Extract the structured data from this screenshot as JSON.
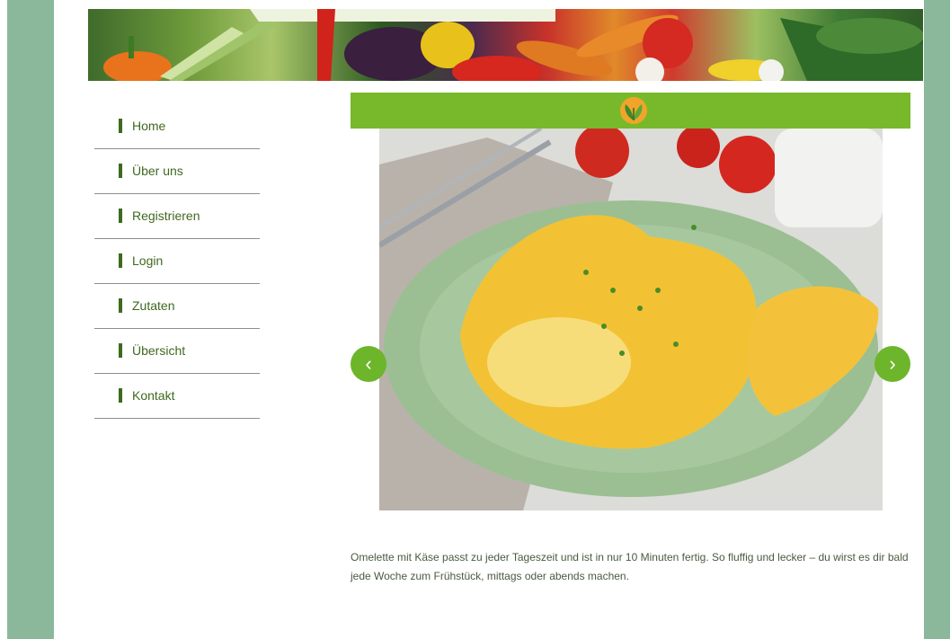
{
  "nav": {
    "items": [
      {
        "label": "Home"
      },
      {
        "label": "Über uns"
      },
      {
        "label": "Registrieren"
      },
      {
        "label": "Login"
      },
      {
        "label": "Zutaten"
      },
      {
        "label": "Übersicht"
      },
      {
        "label": "Kontakt"
      }
    ]
  },
  "slider": {
    "prev_label": "‹",
    "next_label": "›"
  },
  "caption": "Omelette mit Käse passt zu jeder Tageszeit und ist in nur 10 Minuten fertig. So fluffig und lecker – du wirst es dir bald jede Woche zum Frühstück, mittags oder abends machen.",
  "colors": {
    "accent": "#77b92a",
    "nav_text": "#3f6820",
    "side_band": "#8bb89a"
  },
  "icons": {
    "logo": "leaf-logo-icon",
    "prev": "chevron-left-icon",
    "next": "chevron-right-icon"
  }
}
